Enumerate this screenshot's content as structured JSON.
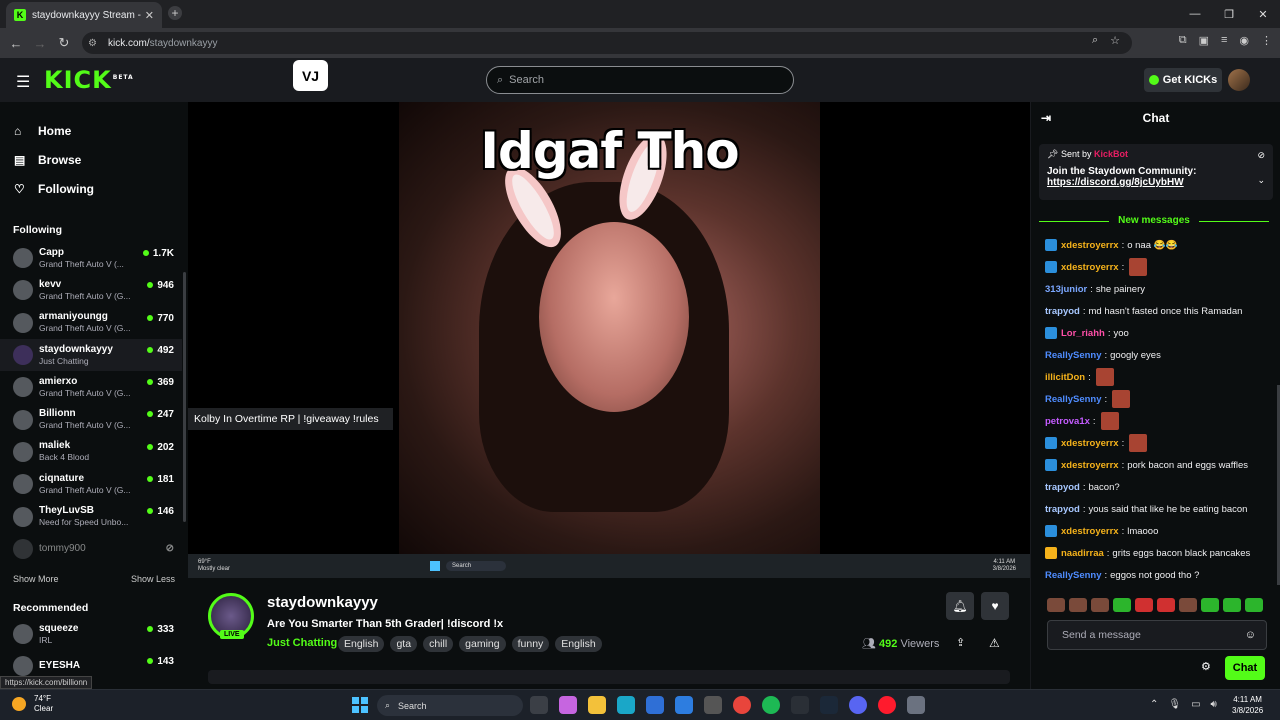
{
  "browser": {
    "tab_title": "staydownkayyy Stream - Watch",
    "tab_icon": "K",
    "url_host": "kick.com/",
    "url_path": "staydownkayyy"
  },
  "header": {
    "logo": "KICK",
    "logo_sup": "BETA",
    "search_placeholder": "Search",
    "get_kicks": "Get KICKs"
  },
  "sidebar": {
    "nav": [
      {
        "label": "Home",
        "icon": "home-icon"
      },
      {
        "label": "Browse",
        "icon": "browse-icon"
      },
      {
        "label": "Following",
        "icon": "heart-icon"
      }
    ],
    "following_title": "Following",
    "following": [
      {
        "name": "Capp",
        "game": "Grand Theft Auto V (...",
        "viewers": "1.7K"
      },
      {
        "name": "kevv",
        "game": "Grand Theft Auto V (G...",
        "viewers": "946"
      },
      {
        "name": "armaniyoungg",
        "game": "Grand Theft Auto V (G...",
        "viewers": "770"
      },
      {
        "name": "staydownkayyy",
        "game": "Just Chatting",
        "viewers": "492"
      },
      {
        "name": "amierxo",
        "game": "Grand Theft Auto V (G...",
        "viewers": "369"
      },
      {
        "name": "Billionn",
        "game": "Grand Theft Auto V (G...",
        "viewers": "247"
      },
      {
        "name": "maliek",
        "game": "Back 4 Blood",
        "viewers": "202"
      },
      {
        "name": "ciqnature",
        "game": "Grand Theft Auto V (G...",
        "viewers": "181"
      },
      {
        "name": "TheyLuvSB",
        "game": "Need for Speed Unbo...",
        "viewers": "146"
      }
    ],
    "offline": {
      "name": "tommy900"
    },
    "show_more": "Show More",
    "show_less": "Show Less",
    "recommended_title": "Recommended",
    "recommended": [
      {
        "name": "squeeze",
        "game": "IRL",
        "viewers": "333"
      },
      {
        "name": "EYESHA",
        "game": "",
        "viewers": "143"
      }
    ]
  },
  "video": {
    "caption": "Idgaf Tho",
    "tooltip": "Kolby In Overtime RP | !giveaway !rules",
    "inner_search": "Search",
    "inner_weather_temp": "69°F",
    "inner_weather_desc": "Mostly clear",
    "inner_time": "4:11 AM",
    "inner_date": "3/8/2026"
  },
  "channel": {
    "name": "staydownkayyy",
    "live": "LIVE",
    "title": "Are You Smarter Than 5th Grader| !discord !x",
    "category": "Just Chatting",
    "tags": [
      "English",
      "gta",
      "chill",
      "gaming",
      "funny",
      "English"
    ],
    "viewers": "492",
    "viewers_label": "Viewers"
  },
  "chat": {
    "title": "Chat",
    "pinned_sentby": "Sent by",
    "pinned_bot": "KickBot",
    "pinned_text": "Join the Staydown Community:",
    "pinned_link": "https://discord.gg/8jcUybHW",
    "new_messages": "New messages",
    "messages": [
      {
        "user": "xdestroyerrx",
        "color": "#f5b21b",
        "text": "o naa 😂😂",
        "badge": "blue"
      },
      {
        "user": "xdestroyerrx",
        "color": "#f5b21b",
        "text": "",
        "badge": "blue",
        "emote": true
      },
      {
        "user": "313junior",
        "color": "#7ba7ff",
        "text": "she painery",
        "badge": ""
      },
      {
        "user": "trapyod",
        "color": "#a8c8ff",
        "text": "md hasn't fasted once this Ramadan",
        "badge": ""
      },
      {
        "user": "Lor_riahh",
        "color": "#ff4fa8",
        "text": "yoo",
        "badge": "blue"
      },
      {
        "user": "ReallySenny",
        "color": "#4f8cff",
        "text": "googly eyes",
        "badge": ""
      },
      {
        "user": "illicitDon",
        "color": "#f5b21b",
        "text": "",
        "badge": "",
        "emote": true
      },
      {
        "user": "ReallySenny",
        "color": "#4f8cff",
        "text": "",
        "badge": "",
        "emote": true
      },
      {
        "user": "petrova1x",
        "color": "#c45cff",
        "text": "",
        "badge": "",
        "emote": true
      },
      {
        "user": "xdestroyerrx",
        "color": "#f5b21b",
        "text": "",
        "badge": "blue",
        "emote": true
      },
      {
        "user": "xdestroyerrx",
        "color": "#f5b21b",
        "text": "pork bacon and eggs waffles",
        "badge": "blue"
      },
      {
        "user": "trapyod",
        "color": "#a8c8ff",
        "text": "bacon?",
        "badge": ""
      },
      {
        "user": "trapyod",
        "color": "#a8c8ff",
        "text": "yous said that like he be eating bacon",
        "badge": ""
      },
      {
        "user": "xdestroyerrx",
        "color": "#f5b21b",
        "text": "lmaooo",
        "badge": "blue"
      },
      {
        "user": "naadirraa",
        "color": "#f5b21b",
        "text": "grits eggs bacon black pancakes",
        "badge": "yellow"
      },
      {
        "user": "ReallySenny",
        "color": "#4f8cff",
        "text": "eggos not good tho ?",
        "badge": ""
      }
    ],
    "input_placeholder": "Send a message",
    "send_label": "Chat"
  },
  "status_url": "https://kick.com/billionn",
  "taskbar": {
    "temp": "74°F",
    "weather": "Clear",
    "search": "Search",
    "time": "4:11 AM",
    "date": "3/8/2026"
  }
}
